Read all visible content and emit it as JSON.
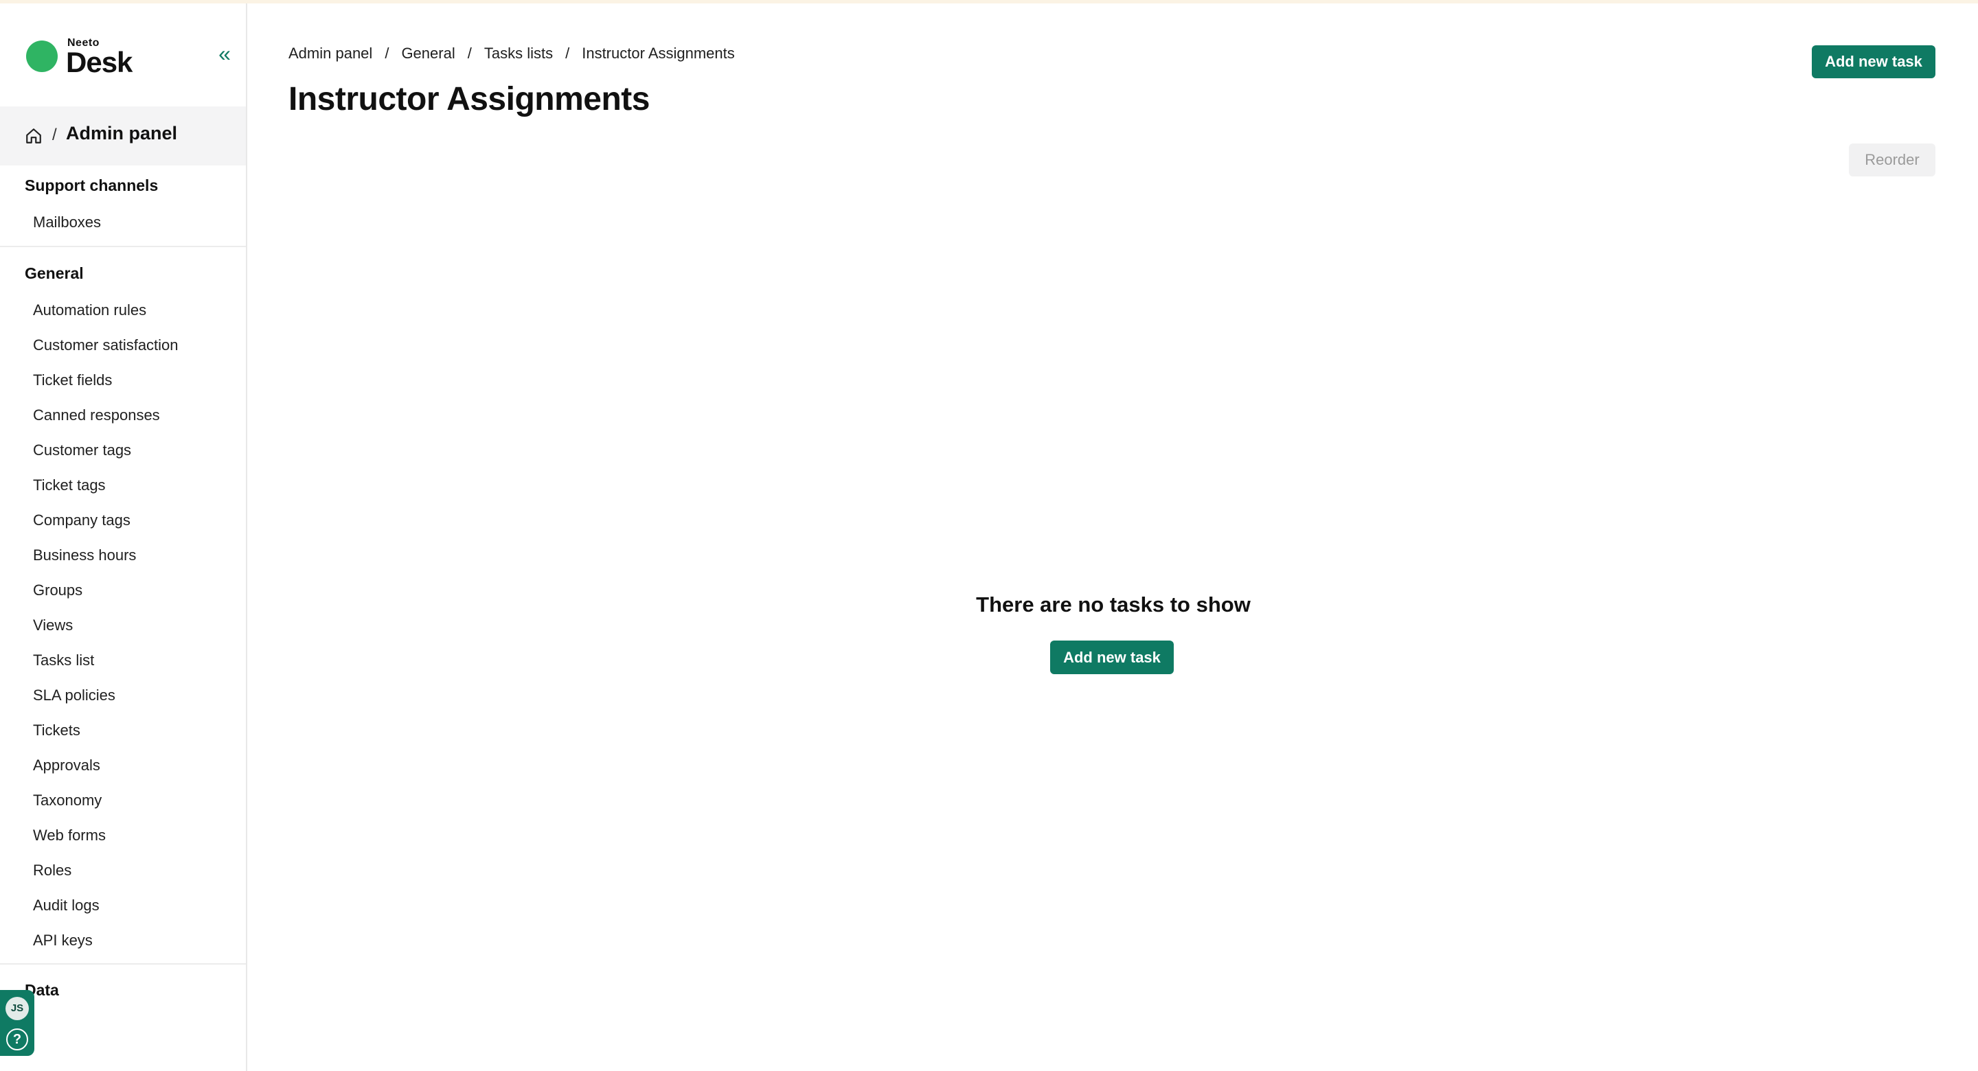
{
  "app": {
    "logo_small": "Neeto",
    "logo_big": "Desk"
  },
  "sidebar": {
    "admin_label": "Admin panel",
    "sections": [
      {
        "title": "Support channels",
        "items": [
          "Mailboxes"
        ]
      },
      {
        "title": "General",
        "items": [
          "Automation rules",
          "Customer satisfaction",
          "Ticket fields",
          "Canned responses",
          "Customer tags",
          "Ticket tags",
          "Company tags",
          "Business hours",
          "Groups",
          "Views",
          "Tasks list",
          "SLA policies",
          "Tickets",
          "Approvals",
          "Taxonomy",
          "Web forms",
          "Roles",
          "Audit logs",
          "API keys"
        ]
      },
      {
        "title": "Data",
        "items": []
      }
    ],
    "user_initials": "JS"
  },
  "breadcrumb": [
    "Admin panel",
    "General",
    "Tasks lists",
    "Instructor Assignments"
  ],
  "breadcrumb_separator": "/",
  "page": {
    "title": "Instructor Assignments",
    "add_task_label": "Add new task",
    "reorder_label": "Reorder",
    "empty_message": "There are no tasks to show",
    "empty_add_label": "Add new task"
  },
  "colors": {
    "accent": "#0f7a63",
    "logo_green": "#2fb463"
  },
  "icons": {
    "collapse": "double-chevron-left-icon",
    "home": "home-icon",
    "help": "help-icon"
  }
}
